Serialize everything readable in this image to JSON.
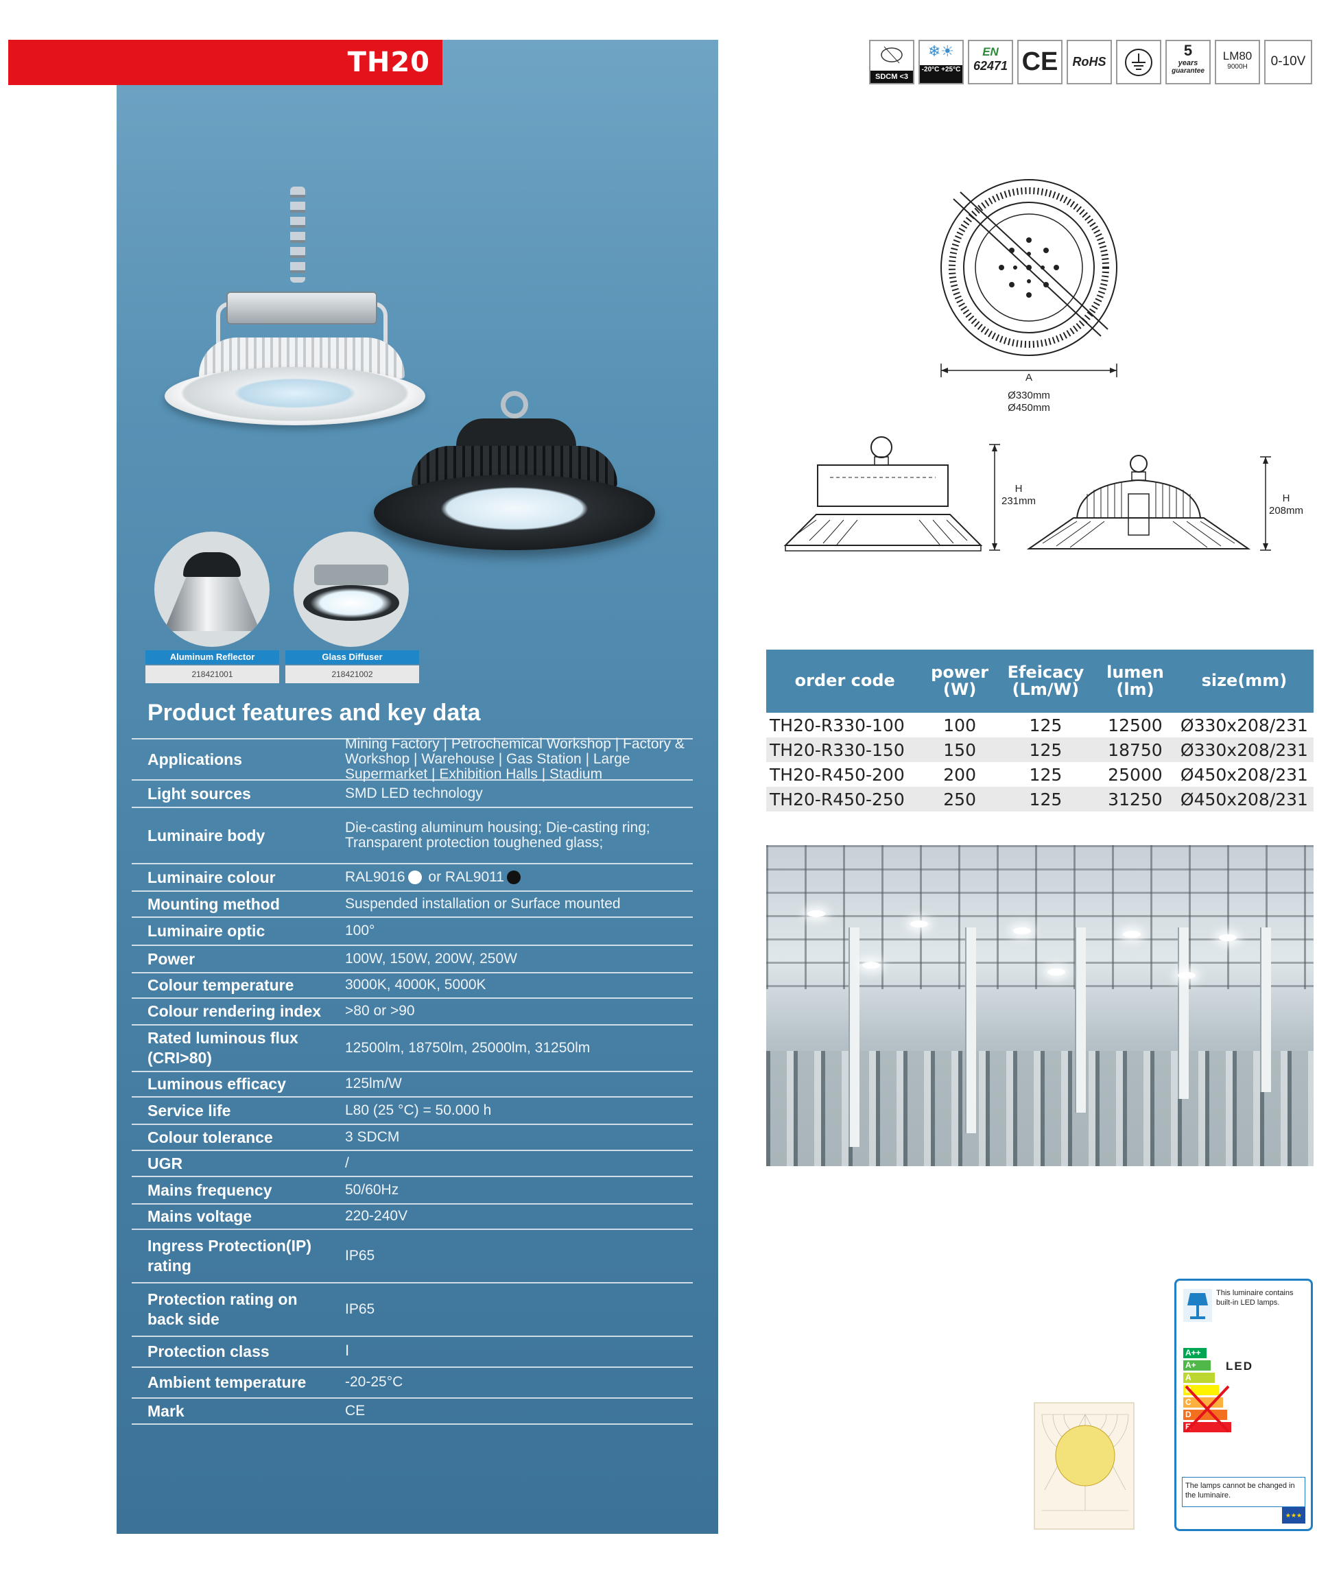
{
  "header": {
    "model": "TH20"
  },
  "certifications": [
    {
      "name": "sdcm-icon",
      "text": "SDCM <3"
    },
    {
      "name": "temperature-icon",
      "text": "-20°C +25°C"
    },
    {
      "name": "en-standard-icon",
      "line1": "EN",
      "line2": "62471"
    },
    {
      "name": "ce-mark-icon",
      "text": "CE"
    },
    {
      "name": "rohs-icon",
      "text": "RoHS"
    },
    {
      "name": "ground-icon",
      "text": ""
    },
    {
      "name": "guarantee-icon",
      "line1": "5",
      "line2": "years",
      "line3": "guarantee"
    },
    {
      "name": "lm80-icon",
      "line1": "LM80",
      "line2": "9000H"
    },
    {
      "name": "dimming-icon",
      "text": "0-10V"
    }
  ],
  "accessories": [
    {
      "label": "Aluminum Reflector",
      "code": "218421001"
    },
    {
      "label": "Glass Diffuser",
      "code": "218421002"
    }
  ],
  "features": {
    "title": "Product features and key data",
    "rows": [
      {
        "label": "Applications",
        "value": "Mining Factory | Petrochemical Workshop | Factory & Workshop | Warehouse | Gas Station | Large Supermarket | Exhibition Halls | Stadium"
      },
      {
        "label": "Light sources",
        "value": "SMD LED technology"
      },
      {
        "label": "Luminaire body",
        "value": "Die-casting aluminum housing; Die-casting ring; Transparent protection toughened glass;"
      },
      {
        "label": "Luminaire colour",
        "value_a": "RAL9016",
        "value_b": "or RAL9011"
      },
      {
        "label": "Mounting method",
        "value": "Suspended installation or Surface mounted"
      },
      {
        "label": "Luminaire optic",
        "value": "100°"
      },
      {
        "label": "Power",
        "value": "100W, 150W, 200W, 250W"
      },
      {
        "label": "Colour temperature",
        "value": "3000K, 4000K, 5000K"
      },
      {
        "label": "Colour rendering index",
        "value": ">80 or >90"
      },
      {
        "label": "Rated luminous flux (CRI>80)",
        "value": "12500lm, 18750lm, 25000lm, 31250lm"
      },
      {
        "label": "Luminous efficacy",
        "value": "125lm/W"
      },
      {
        "label": "Service life",
        "value": "L80 (25 °C) = 50.000 h"
      },
      {
        "label": "Colour tolerance",
        "value": "3 SDCM"
      },
      {
        "label": "UGR",
        "value": "/"
      },
      {
        "label": "Mains frequency",
        "value": "50/60Hz"
      },
      {
        "label": "Mains voltage",
        "value": "220-240V"
      },
      {
        "label": "Ingress Protection(IP) rating",
        "value": "IP65"
      },
      {
        "label": "Protection rating on back side",
        "value": "IP65"
      },
      {
        "label": "Protection class",
        "value": "Ⅰ"
      },
      {
        "label": "Ambient temperature",
        "value": "-20-25°C"
      },
      {
        "label": "Mark",
        "value": "CE"
      }
    ]
  },
  "drawing": {
    "diameter_label": "A",
    "diameter_1": "Ø330mm",
    "diameter_2": "Ø450mm",
    "height_1_label": "H",
    "height_1": "231mm",
    "height_2_label": "H",
    "height_2": "208mm"
  },
  "order_table": {
    "headers": [
      "order code",
      "power (W)",
      "Efeicacy (Lm/W)",
      "lumen (lm)",
      "size(mm)"
    ],
    "rows": [
      [
        "TH20-R330-100",
        "100",
        "125",
        "12500",
        "Ø330x208/231"
      ],
      [
        "TH20-R330-150",
        "150",
        "125",
        "18750",
        "Ø330x208/231"
      ],
      [
        "TH20-R450-200",
        "200",
        "125",
        "25000",
        "Ø450x208/231"
      ],
      [
        "TH20-R450-250",
        "250",
        "125",
        "31250",
        "Ø450x208/231"
      ]
    ]
  },
  "energy_label": {
    "top_text": "This luminaire contains built-in LED lamps.",
    "led": "LED",
    "classes": [
      "A++",
      "A+",
      "A",
      "B",
      "C",
      "D",
      "E"
    ],
    "bottom_text": "The lamps cannot be changed in the luminaire."
  },
  "colors": {
    "title_red": "#e4121b",
    "panel_blue": "#4a87ad",
    "accessory_blue": "#1f86c8",
    "white_dot": "#ffffff",
    "black_dot": "#111111"
  }
}
